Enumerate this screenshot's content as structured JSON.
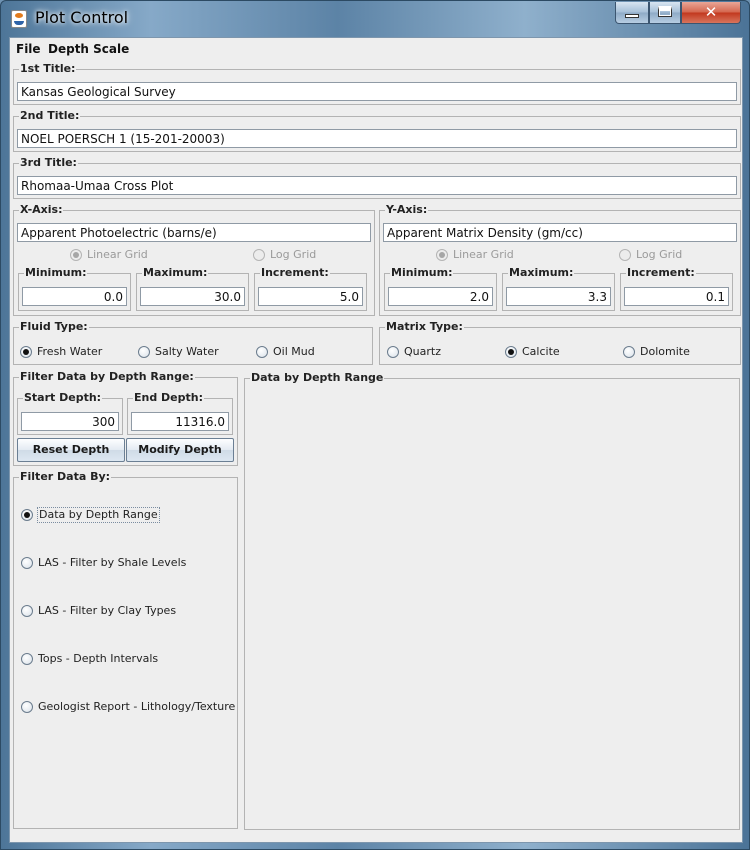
{
  "window": {
    "title": "Plot Control"
  },
  "menu": [
    "File",
    "Depth Scale"
  ],
  "titles": {
    "first": {
      "label": "1st Title:",
      "value": "Kansas Geological Survey"
    },
    "second": {
      "label": "2nd Title:",
      "value": "NOEL POERSCH 1 (15-201-20003)"
    },
    "third": {
      "label": "3rd Title:",
      "value": "Rhomaa-Umaa Cross Plot"
    }
  },
  "x_axis": {
    "label": "X-Axis:",
    "value": "Apparent Photoelectric (barns/e)",
    "linear_grid": "Linear Grid",
    "log_grid": "Log Grid",
    "selected_grid": "linear",
    "minimum": {
      "label": "Minimum:",
      "value": "0.0"
    },
    "maximum": {
      "label": "Maximum:",
      "value": "30.0"
    },
    "increment": {
      "label": "Increment:",
      "value": "5.0"
    }
  },
  "y_axis": {
    "label": "Y-Axis:",
    "value": "Apparent Matrix Density (gm/cc)",
    "linear_grid": "Linear Grid",
    "log_grid": "Log Grid",
    "selected_grid": "linear",
    "minimum": {
      "label": "Minimum:",
      "value": "2.0"
    },
    "maximum": {
      "label": "Maximum:",
      "value": "3.3"
    },
    "increment": {
      "label": "Increment:",
      "value": "0.1"
    }
  },
  "fluid_type": {
    "label": "Fluid Type:",
    "options": [
      "Fresh Water",
      "Salty Water",
      "Oil Mud"
    ],
    "selected": "Fresh Water"
  },
  "matrix_type": {
    "label": "Matrix Type:",
    "options": [
      "Quartz",
      "Calcite",
      "Dolomite"
    ],
    "selected": "Calcite"
  },
  "depth_filter": {
    "label": "Filter Data by Depth Range:",
    "start": {
      "label": "Start Depth:",
      "value": "300"
    },
    "end": {
      "label": "End Depth:",
      "value": "11316.0"
    },
    "reset_button": "Reset Depth",
    "modify_button": "Modify Depth"
  },
  "filter_by": {
    "label": "Filter Data By:",
    "options": [
      "Data by Depth Range",
      "LAS - Filter by Shale Levels",
      "LAS - Filter by Clay Types",
      "Tops - Depth Intervals",
      "Geologist Report - Lithology/Texture"
    ],
    "selected": "Data by Depth Range"
  },
  "panel": {
    "label": "Data by Depth Range"
  }
}
